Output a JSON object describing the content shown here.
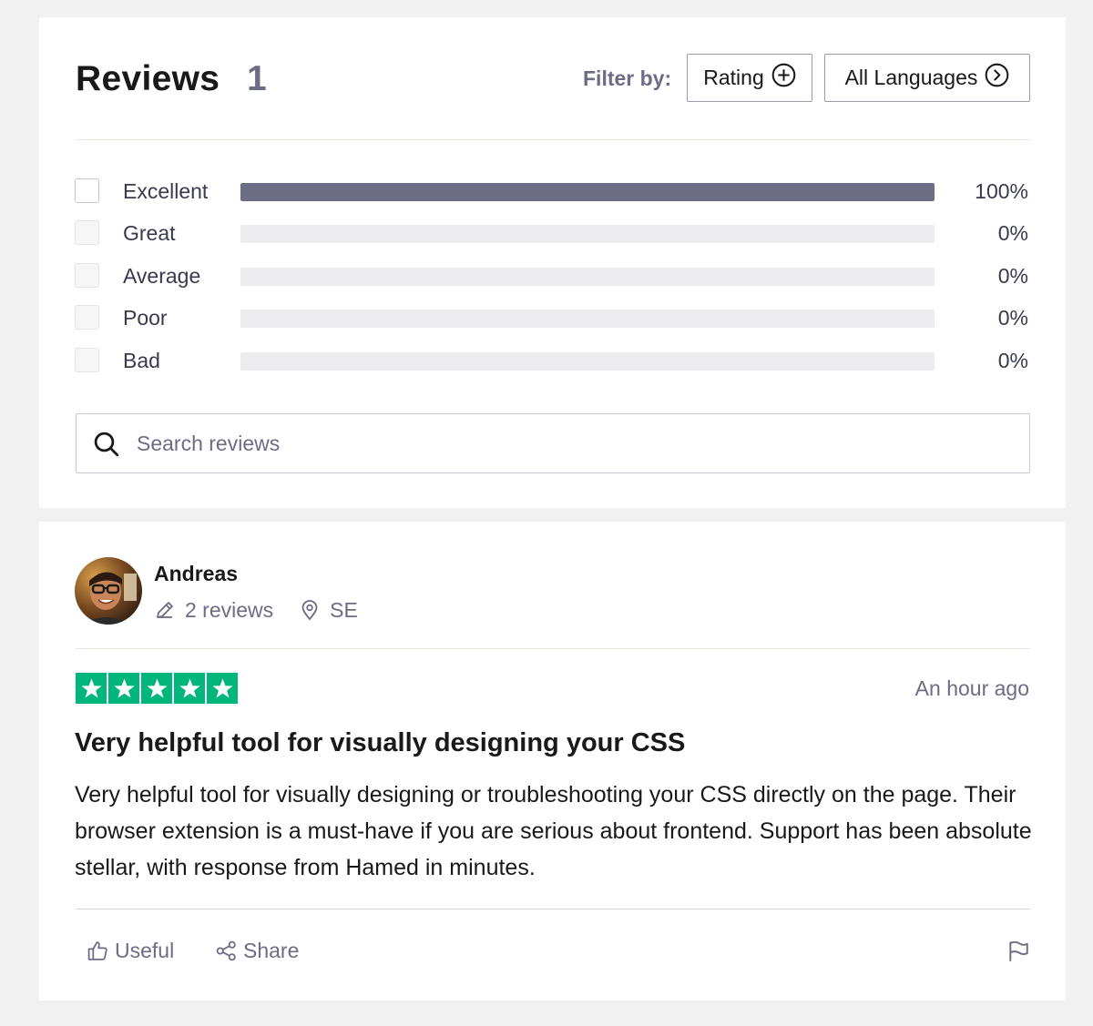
{
  "header": {
    "title": "Reviews",
    "count": "1",
    "filter_label": "Filter by:",
    "rating_button": "Rating",
    "language_button": "All Languages"
  },
  "ratings": [
    {
      "label": "Excellent",
      "percent_text": "100%",
      "fraction": 1.0,
      "checkbox_state": "unchecked"
    },
    {
      "label": "Great",
      "percent_text": "0%",
      "fraction": 0.0,
      "checkbox_state": "disabled"
    },
    {
      "label": "Average",
      "percent_text": "0%",
      "fraction": 0.0,
      "checkbox_state": "disabled"
    },
    {
      "label": "Poor",
      "percent_text": "0%",
      "fraction": 0.0,
      "checkbox_state": "disabled"
    },
    {
      "label": "Bad",
      "percent_text": "0%",
      "fraction": 0.0,
      "checkbox_state": "disabled"
    }
  ],
  "search": {
    "placeholder": "Search reviews",
    "value": ""
  },
  "review": {
    "author": "Andreas",
    "review_count": "2 reviews",
    "country": "SE",
    "stars": 5,
    "date": "An hour ago",
    "title": "Very helpful tool for visually designing your CSS",
    "body": "Very helpful tool for visually designing or troubleshooting your CSS directly on the page. Their browser extension is a must-have if you are serious about frontend. Support has been absolute stellar, with response from Hamed in minutes.",
    "useful_label": "Useful",
    "share_label": "Share"
  },
  "colors": {
    "bar_fill": "#6c6c85",
    "bar_track": "#ececef",
    "star_green": "#00b67a",
    "muted_text": "#6c6c85",
    "page_bg": "#f1f1f2"
  },
  "icons": {
    "rating_button": "plus-circle-icon",
    "language_button": "chevron-right-circle-icon",
    "search": "search-icon",
    "reviews_count": "pencil-icon",
    "location": "location-pin-icon",
    "star": "star-icon",
    "useful": "thumbs-up-icon",
    "share": "share-icon",
    "report": "flag-icon"
  }
}
